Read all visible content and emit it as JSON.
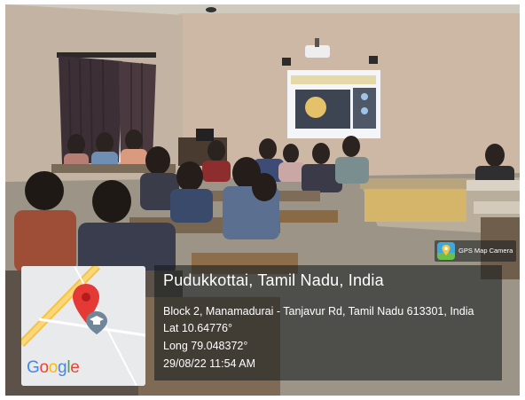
{
  "location": {
    "title": "Pudukkottai, Tamil Nadu, India",
    "address": "Block 2, Manamadurai - Tanjavur Rd, Tamil Nadu 613301, India",
    "latitude": "Lat 10.64776°",
    "longitude": "Long 79.048372°",
    "datetime": "29/08/22 11:54 AM"
  },
  "badge": {
    "label": "GPS Map Camera"
  },
  "map": {
    "logo": [
      "G",
      "o",
      "o",
      "g",
      "l",
      "e"
    ],
    "logo_colors": [
      "#4285F4",
      "#EA4335",
      "#FBBC05",
      "#4285F4",
      "#34A853",
      "#EA4335"
    ],
    "pin_color": "#e53935",
    "road_color": "#f6c342"
  },
  "icons": [
    "location-pin-icon",
    "graduation-cap-icon",
    "gps-map-camera-icon"
  ]
}
